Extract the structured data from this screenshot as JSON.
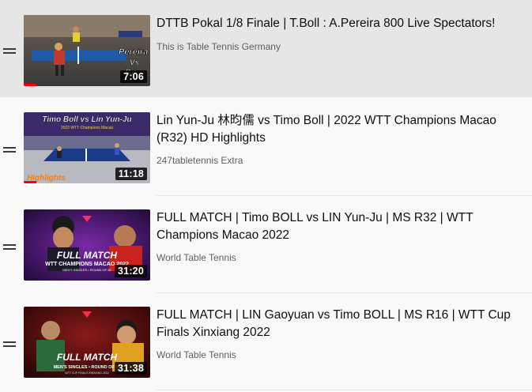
{
  "playlist": {
    "items": [
      {
        "title": "DTTB Pokal 1/8 Finale | T.Boll : A.Pereira 800 Live Spectators!",
        "channel": "This is Table Tennis Germany",
        "duration": "7:06",
        "thumb_text": "Pereira Vs Bo",
        "progress": 0.1,
        "active": true
      },
      {
        "title": "Lin Yun-Ju 林昀儒 vs Timo Boll | 2022 WTT Champions Macao (R32) HD Highlights",
        "channel": "247tabletennis Extra",
        "duration": "11:18",
        "thumb_text": "Timo Boll vs Lin Yun-Ju",
        "thumb_subtext": "Highlights",
        "progress": 0.1,
        "active": false
      },
      {
        "title": "FULL MATCH | Timo BOLL vs LIN Yun-Ju | MS R32 | WTT Champions Macao 2022",
        "channel": "World Table Tennis",
        "duration": "31:20",
        "thumb_text": "FULL MATCH",
        "thumb_subtext": "WTT CHAMPIONS MACAO 2022",
        "progress": 0,
        "active": false
      },
      {
        "title": "FULL MATCH | LIN Gaoyuan vs Timo BOLL | MS R16 | WTT Cup Finals Xinxiang 2022",
        "channel": "World Table Tennis",
        "duration": "31:38",
        "thumb_text": "FULL MATCH",
        "thumb_subtext": "MEN'S SINGLES • ROUND OF 16",
        "progress": 0,
        "active": false
      }
    ]
  },
  "colors": {
    "active_row_bg": "#e6e6e6",
    "page_bg": "#f9f9f9",
    "progress": "#ff0000",
    "title": "#0f0f0f",
    "channel": "#606060"
  },
  "icons": {
    "drag_handle": "drag-handle-icon"
  }
}
